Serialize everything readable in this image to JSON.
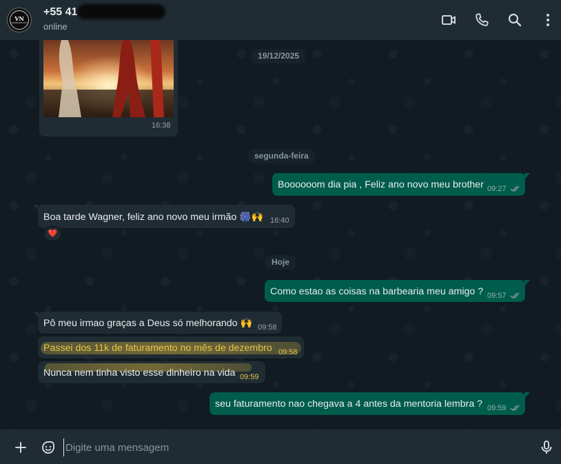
{
  "header": {
    "contact_name": "+55 41 88",
    "status": "online"
  },
  "avatar": {
    "initials": "VN",
    "subtitle": "BARBERSHOP"
  },
  "chat": {
    "media_time": "16:38",
    "dates": {
      "first": "19/12/2025",
      "second": "segunda-feira",
      "third": "Hoje"
    },
    "messages": [
      {
        "dir": "out",
        "text": "Boooooom dia pia , Feliz ano novo meu brother",
        "time": "09:27"
      },
      {
        "dir": "in",
        "text": "Boa tarde Wagner, feliz ano novo meu irmão",
        "emojis": "🎆🙌",
        "time": "16:40",
        "reaction": "❤️"
      },
      {
        "dir": "out",
        "text": "Como estao as coisas na barbearia meu amigo ?",
        "time": "09:57"
      },
      {
        "dir": "in",
        "text": "Pô meu irmao graças a Deus só melhorando",
        "emojis": "🙌",
        "time": "09:58"
      },
      {
        "dir": "in",
        "text": "Passei dos 11k de faturamento no mês de dezembro",
        "time": "09:58",
        "highlighted": true
      },
      {
        "dir": "in",
        "text": "Nunca nem tinha visto esse dinheiro na vida",
        "time": "09:59",
        "highlighted": true
      },
      {
        "dir": "out",
        "text": "seu faturamento nao chegava a 4 antes da mentoria lembra ?",
        "time": "09:59"
      }
    ]
  },
  "composer": {
    "placeholder": "Digite uma mensagem"
  },
  "colors": {
    "header_bg": "#202c33",
    "chat_bg": "#111b21",
    "incoming_bubble": "#202c33",
    "outgoing_bubble": "#005c4b",
    "highlight_text": "#e8c547"
  },
  "icons": [
    "video-call-icon",
    "voice-call-icon",
    "search-icon",
    "menu-icon",
    "attach-icon",
    "sticker-icon",
    "mic-icon",
    "double-check-icon"
  ]
}
